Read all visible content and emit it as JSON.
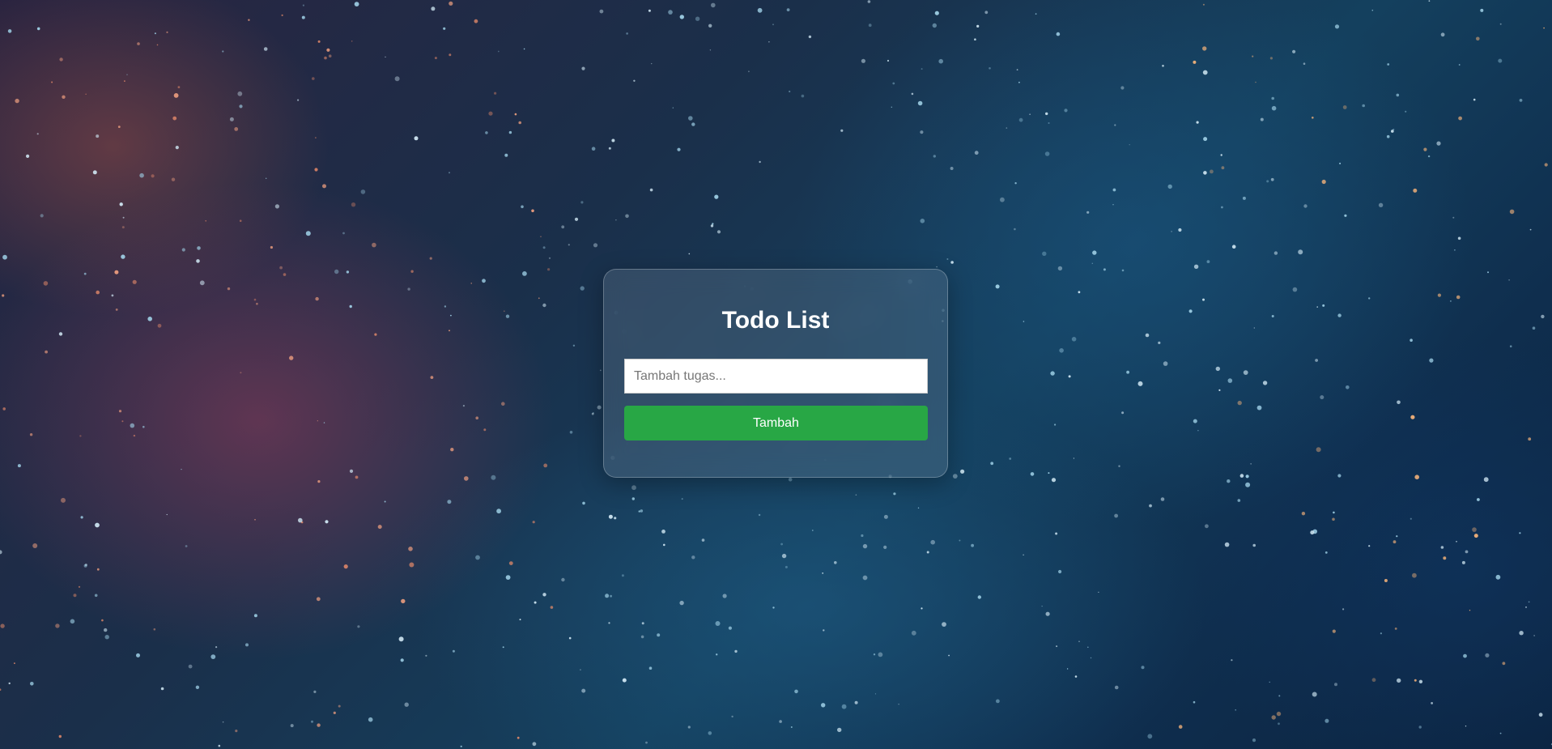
{
  "app": {
    "title": "Todo List"
  },
  "form": {
    "input_value": "",
    "input_placeholder": "Tambah tugas...",
    "add_label": "Tambah"
  },
  "colors": {
    "button_bg": "#28a745",
    "button_text": "#ffffff",
    "title_text": "#ffffff"
  }
}
